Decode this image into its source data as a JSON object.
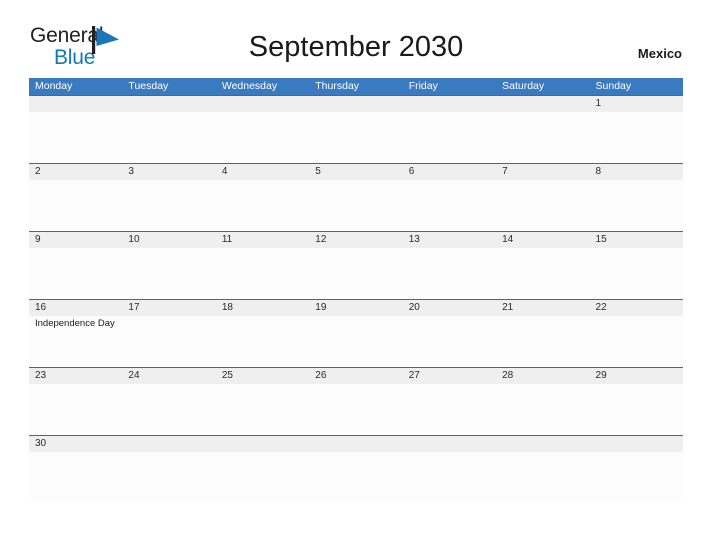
{
  "brand": {
    "logo_part1": "General",
    "logo_part2": "Blue",
    "logo_icon": "flag-triangle-icon",
    "color_dark": "#231f20",
    "color_blue": "#1278be"
  },
  "header": {
    "title": "September 2030",
    "region": "Mexico"
  },
  "calendar": {
    "header_bg": "#3a7ac0",
    "row_divider": "#2e6daf",
    "day_band_bg": "#efefef",
    "weekdays": [
      "Monday",
      "Tuesday",
      "Wednesday",
      "Thursday",
      "Friday",
      "Saturday",
      "Sunday"
    ],
    "weeks": [
      {
        "days": [
          {
            "num": "",
            "event": ""
          },
          {
            "num": "",
            "event": ""
          },
          {
            "num": "",
            "event": ""
          },
          {
            "num": "",
            "event": ""
          },
          {
            "num": "",
            "event": ""
          },
          {
            "num": "",
            "event": ""
          },
          {
            "num": "1",
            "event": ""
          }
        ]
      },
      {
        "days": [
          {
            "num": "2",
            "event": ""
          },
          {
            "num": "3",
            "event": ""
          },
          {
            "num": "4",
            "event": ""
          },
          {
            "num": "5",
            "event": ""
          },
          {
            "num": "6",
            "event": ""
          },
          {
            "num": "7",
            "event": ""
          },
          {
            "num": "8",
            "event": ""
          }
        ]
      },
      {
        "days": [
          {
            "num": "9",
            "event": ""
          },
          {
            "num": "10",
            "event": ""
          },
          {
            "num": "11",
            "event": ""
          },
          {
            "num": "12",
            "event": ""
          },
          {
            "num": "13",
            "event": ""
          },
          {
            "num": "14",
            "event": ""
          },
          {
            "num": "15",
            "event": ""
          }
        ]
      },
      {
        "days": [
          {
            "num": "16",
            "event": "Independence Day"
          },
          {
            "num": "17",
            "event": ""
          },
          {
            "num": "18",
            "event": ""
          },
          {
            "num": "19",
            "event": ""
          },
          {
            "num": "20",
            "event": ""
          },
          {
            "num": "21",
            "event": ""
          },
          {
            "num": "22",
            "event": ""
          }
        ]
      },
      {
        "days": [
          {
            "num": "23",
            "event": ""
          },
          {
            "num": "24",
            "event": ""
          },
          {
            "num": "25",
            "event": ""
          },
          {
            "num": "26",
            "event": ""
          },
          {
            "num": "27",
            "event": ""
          },
          {
            "num": "28",
            "event": ""
          },
          {
            "num": "29",
            "event": ""
          }
        ]
      },
      {
        "days": [
          {
            "num": "30",
            "event": ""
          },
          {
            "num": "",
            "event": ""
          },
          {
            "num": "",
            "event": ""
          },
          {
            "num": "",
            "event": ""
          },
          {
            "num": "",
            "event": ""
          },
          {
            "num": "",
            "event": ""
          },
          {
            "num": "",
            "event": ""
          }
        ]
      }
    ]
  }
}
